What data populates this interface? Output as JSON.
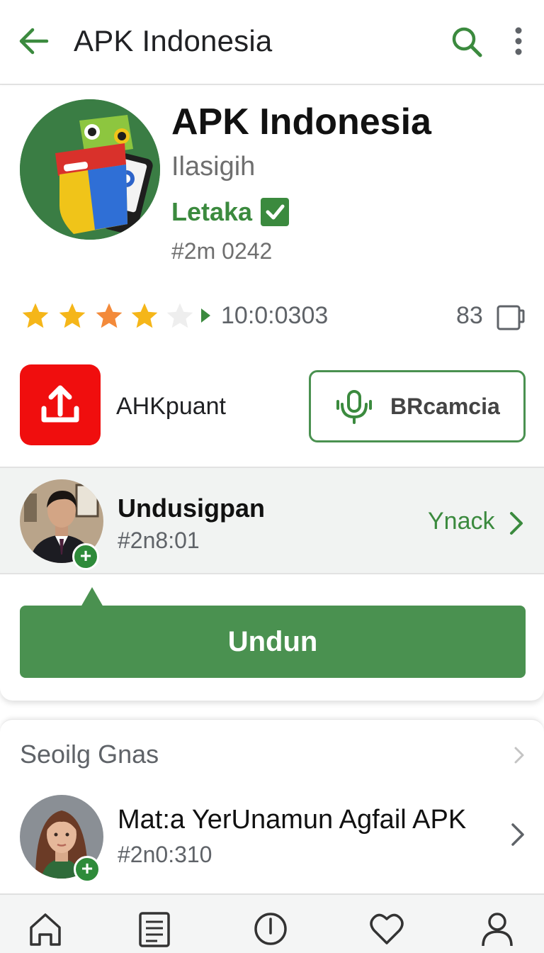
{
  "topbar": {
    "title": "APK Indonesia"
  },
  "app": {
    "name": "APK Indonesia",
    "developer": "Ilasigih",
    "tag": "Letaka",
    "id": "#2m 0242",
    "rating": 4,
    "rating_max": 5,
    "rating_count": "10:0:0303",
    "downloads_count": "83"
  },
  "actions": {
    "share_label": "AHKpuant",
    "secondary_label": "BRcamcia"
  },
  "author": {
    "name": "Undusigpan",
    "id": "#2n8:01",
    "link_label": "Ynack"
  },
  "download": {
    "label": "Undun"
  },
  "similar": {
    "title": "Seoilg Gnas",
    "items": [
      {
        "title": "Mat:a YerUnamun Agfail APK",
        "id": "#2n0:310"
      }
    ]
  },
  "bottom_nav": {
    "items": [
      {
        "icon": "home-icon",
        "label": ""
      },
      {
        "icon": "list-icon",
        "label": ""
      },
      {
        "icon": "info-icon",
        "label": ""
      },
      {
        "icon": "heart-icon",
        "label": ""
      },
      {
        "icon": "profile-icon",
        "label": ""
      }
    ]
  },
  "colors": {
    "accent_green": "#3b8a3e",
    "button_green": "#4a9150",
    "share_red": "#f00e0e",
    "star_yellow": "#f5b619",
    "star_orange": "#f38a3a"
  }
}
